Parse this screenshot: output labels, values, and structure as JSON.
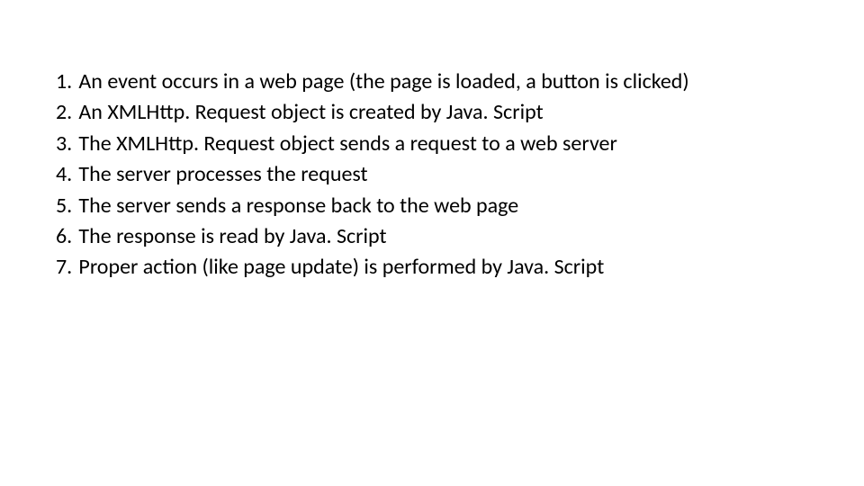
{
  "list": {
    "items": [
      {
        "n": "1.",
        "text": "An event occurs in a web page (the page is loaded, a button is clicked)"
      },
      {
        "n": "2.",
        "text": "An XMLHttp. Request object is created by Java. Script"
      },
      {
        "n": "3.",
        "text": "The XMLHttp. Request object sends a request to a web server"
      },
      {
        "n": "4.",
        "text": "The server processes the request"
      },
      {
        "n": "5.",
        "text": "The server sends a response back to the web page"
      },
      {
        "n": "6.",
        "text": "The response is read by Java. Script"
      },
      {
        "n": "7.",
        "text": "Proper action (like page update) is performed by Java. Script"
      }
    ]
  }
}
